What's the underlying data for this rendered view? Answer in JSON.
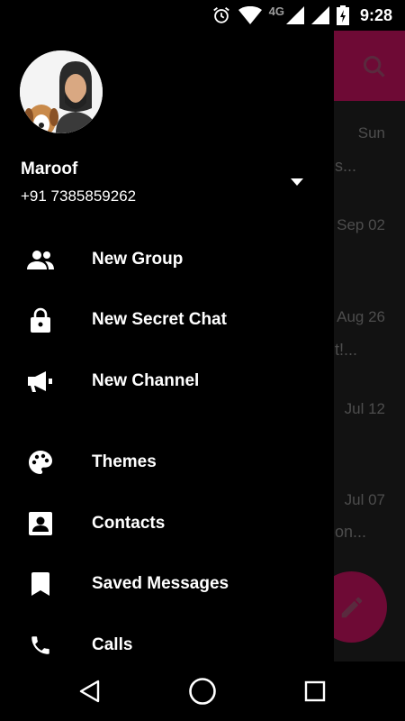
{
  "status_bar": {
    "time": "9:28",
    "network": "4G",
    "icons": [
      "alarm-icon",
      "wifi-icon",
      "signal-icon",
      "signal-icon",
      "battery-charging-icon"
    ]
  },
  "background": {
    "dates": [
      "Sun",
      "Sep 02",
      "Aug 26",
      "Jul 12",
      "Jul 07"
    ],
    "previews": [
      "s...",
      "t!...",
      "on..."
    ]
  },
  "drawer": {
    "user": {
      "name": "Maroof",
      "phone": "+91 7385859262"
    },
    "menu": [
      {
        "label": "New Group",
        "icon": "group-icon"
      },
      {
        "label": "New Secret Chat",
        "icon": "lock-icon"
      },
      {
        "label": "New Channel",
        "icon": "megaphone-icon"
      },
      {
        "label": "Themes",
        "icon": "palette-icon"
      },
      {
        "label": "Contacts",
        "icon": "contact-icon"
      },
      {
        "label": "Saved Messages",
        "icon": "bookmark-icon"
      },
      {
        "label": "Calls",
        "icon": "phone-icon"
      }
    ]
  },
  "colors": {
    "accent": "#6e0a35",
    "drawer_bg": "#000000",
    "text": "#ffffff",
    "dim_text": "#4d4d4d"
  }
}
